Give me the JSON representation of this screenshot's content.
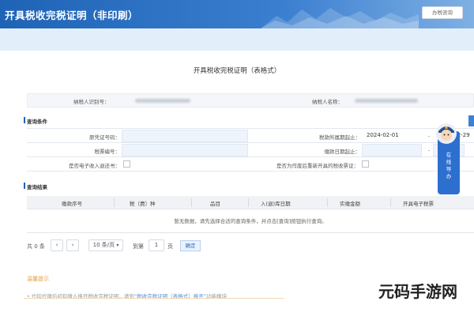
{
  "header": {
    "title": "开具税收完税证明（非印刷）",
    "button": "办税咨询"
  },
  "page_title": "开具税收完税证明（表格式）",
  "taxpayer": {
    "id_label": "纳税人识别号：",
    "name_label": "纳税人名称："
  },
  "query": {
    "section": "查询条件",
    "fields": {
      "voucher_no": "原凭证号码：",
      "tax_period_start": "税款所属期起止：",
      "tax_period_from": "2024-02-01",
      "tax_period_sep": "-",
      "tax_period_to": "2024-02-29",
      "tax_code": "税票编号：",
      "paid_date": "缴款日期起止：",
      "paid_date_sep": "-",
      "e_notice": "是否电子收入退还书：",
      "reissue": "是否为作废后重新开具的税收票证："
    }
  },
  "results": {
    "section": "查询结果",
    "columns": [
      "缴款序号",
      "税（费）种",
      "品目",
      "入(退)库日期",
      "实缴金额",
      "开具电子税票"
    ],
    "empty_text": "暂无数据，请先选择合适的查询条件，并点击[查询]按钮执行查询。"
  },
  "pager": {
    "total": "共 0 条",
    "page_size": "10 条/页",
    "goto_label": "到第",
    "page": "1",
    "unit": "页",
    "confirm": "确定"
  },
  "tips": {
    "title": "温馨提示",
    "text_before": "• 代扣代缴后初扣缴人换开税收完税证明，请到",
    "link": "“税收完税证明（表格式）换开”",
    "text_after": "功能模块"
  },
  "service": {
    "text": "在线导办"
  },
  "watermark": "元码手游网",
  "colors": {
    "brand": "#1f63b6",
    "accent": "#3b82d6",
    "tip": "#e6a23c"
  }
}
